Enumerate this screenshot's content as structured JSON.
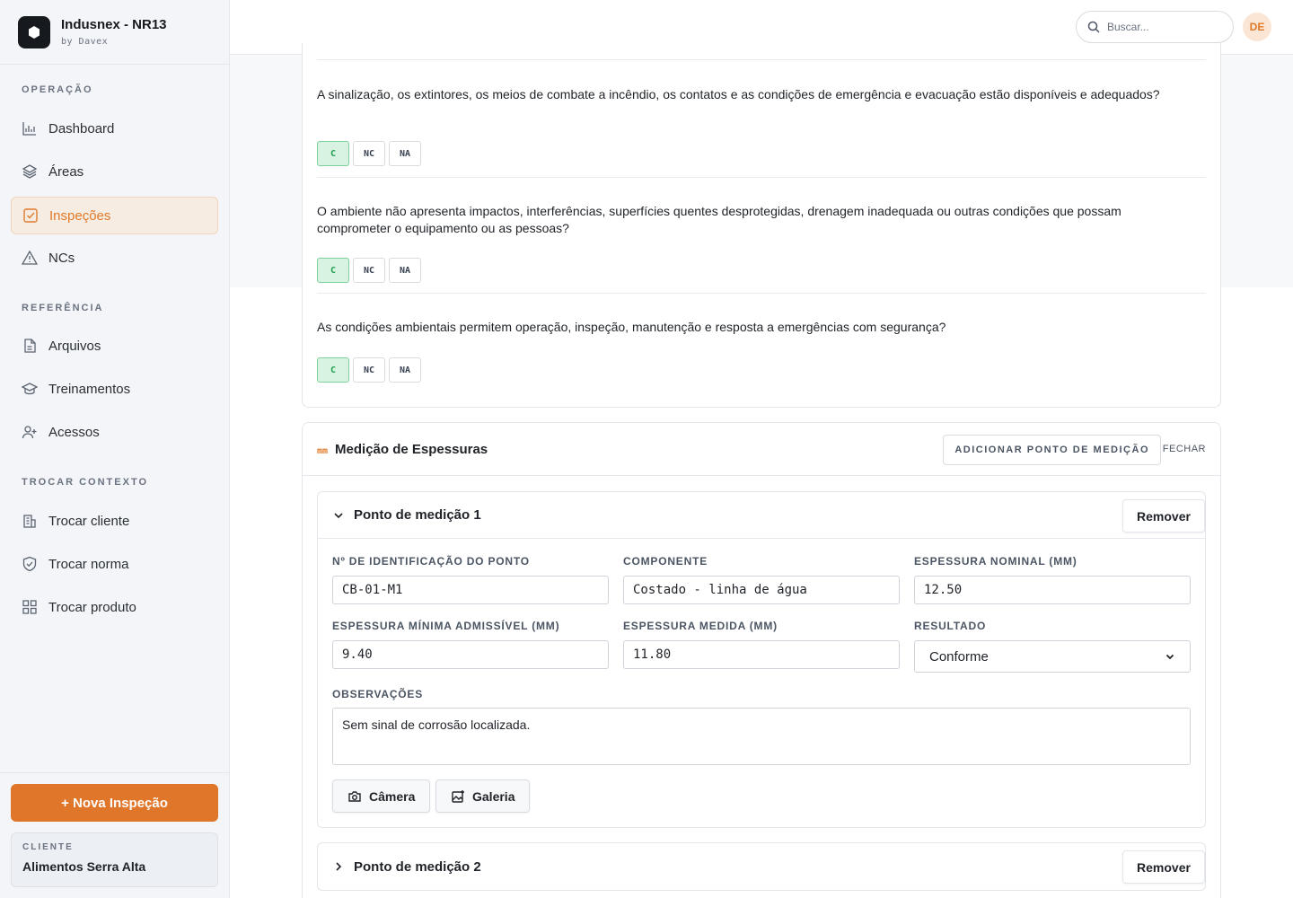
{
  "brand": {
    "title": "Indusnex - NR13",
    "subtitle": "by Davex"
  },
  "sidebar": {
    "sections": [
      {
        "label": "OPERAÇÃO"
      },
      {
        "label": "REFERÊNCIA"
      },
      {
        "label": "TROCAR CONTEXTO"
      }
    ],
    "items": [
      {
        "label": "Dashboard",
        "icon": "chart-icon"
      },
      {
        "label": "Áreas",
        "icon": "layers-icon"
      },
      {
        "label": "Inspeções",
        "icon": "checkbox-icon",
        "active": true
      },
      {
        "label": "NCs",
        "icon": "warning-icon"
      },
      {
        "label": "Arquivos",
        "icon": "file-icon"
      },
      {
        "label": "Treinamentos",
        "icon": "graduation-icon"
      },
      {
        "label": "Acessos",
        "icon": "user-plus-icon"
      },
      {
        "label": "Trocar cliente",
        "icon": "building-icon"
      },
      {
        "label": "Trocar norma",
        "icon": "shield-icon"
      },
      {
        "label": "Trocar produto",
        "icon": "grid-icon"
      }
    ],
    "new_button": "+ Nova Inspeção",
    "client_label": "CLIENTE",
    "client_name": "Alimentos Serra Alta"
  },
  "topbar": {
    "search_placeholder": "Buscar...",
    "avatar": "DE"
  },
  "questions": [
    {
      "text": "A sinalização, os extintores, os meios de combate a incêndio, os contatos e as condições de emergência e evacuação estão disponíveis e adequados?",
      "selected": "C"
    },
    {
      "text": "O ambiente não apresenta impactos, interferências, superfícies quentes desprotegidas, drenagem inadequada ou outras condições que possam comprometer o equipamento ou as pessoas?",
      "selected": "C"
    },
    {
      "text": "As condições ambientais permitem operação, inspeção, manutenção e resposta a emergências com segurança?",
      "selected": "C"
    }
  ],
  "options": [
    "C",
    "NC",
    "NA"
  ],
  "measurement": {
    "icon_text": "mm",
    "title": "Medição de Espessuras",
    "add_button": "ADICIONAR PONTO DE MEDIÇÃO",
    "close": "FECHAR",
    "remove_label": "Remover",
    "points": [
      {
        "title": "Ponto de medição 1",
        "labels": {
          "id": "Nº DE IDENTIFICAÇÃO DO PONTO",
          "component": "COMPONENTE",
          "nominal": "ESPESSURA NOMINAL (MM)",
          "min": "ESPESSURA MÍNIMA ADMISSÍVEL (MM)",
          "measured": "ESPESSURA MEDIDA (MM)",
          "result": "RESULTADO",
          "notes": "OBSERVAÇÕES"
        },
        "values": {
          "id": "CB-01-M1",
          "component": "Costado - linha de água",
          "nominal": "12.50",
          "min": "9.40",
          "measured": "11.80",
          "result": "Conforme",
          "notes": "Sem sinal de corrosão localizada."
        },
        "camera": "Câmera",
        "gallery": "Galeria"
      },
      {
        "title": "Ponto de medição 2"
      }
    ]
  },
  "colors": {
    "accent": "#e0762a",
    "selected_green": "#1f9d4f"
  }
}
